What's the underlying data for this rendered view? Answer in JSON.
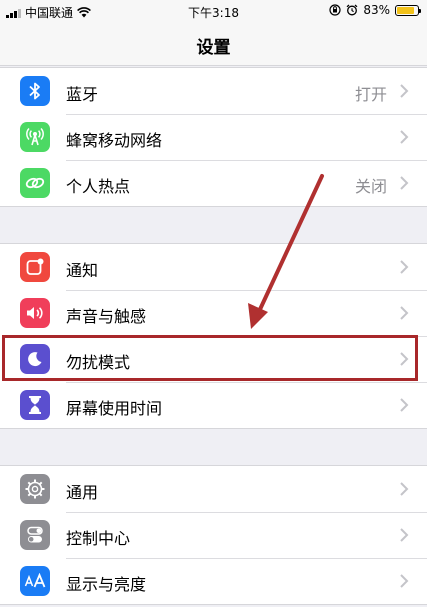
{
  "status_bar": {
    "carrier": "中国联通",
    "time": "下午3:18",
    "battery_percent": "83%",
    "battery_level": 0.83
  },
  "nav": {
    "title": "设置"
  },
  "groups": [
    {
      "items": [
        {
          "label": "蓝牙",
          "value": "打开",
          "icon": "bluetooth-icon",
          "color": "#1a7cf5"
        },
        {
          "label": "蜂窝移动网络",
          "value": "",
          "icon": "cellular-antenna-icon",
          "color": "#4cd964"
        },
        {
          "label": "个人热点",
          "value": "关闭",
          "icon": "personal-hotspot-icon",
          "color": "#4cd964"
        }
      ]
    },
    {
      "items": [
        {
          "label": "通知",
          "value": "",
          "icon": "notifications-icon",
          "color": "#f0483e"
        },
        {
          "label": "声音与触感",
          "value": "",
          "icon": "speaker-icon",
          "color": "#f03e5a"
        },
        {
          "label": "勿扰模式",
          "value": "",
          "icon": "moon-icon",
          "color": "#5b4fcf"
        },
        {
          "label": "屏幕使用时间",
          "value": "",
          "icon": "hourglass-icon",
          "color": "#5b4fcf"
        }
      ]
    },
    {
      "items": [
        {
          "label": "通用",
          "value": "",
          "icon": "gear-icon",
          "color": "#8e8e93"
        },
        {
          "label": "控制中心",
          "value": "",
          "icon": "toggle-switches-icon",
          "color": "#8e8e93"
        },
        {
          "label": "显示与亮度",
          "value": "",
          "icon": "display-text-size-icon",
          "color": "#1a7cf5"
        }
      ]
    }
  ],
  "annotation": {
    "highlight_color": "#a8282a",
    "arrow_color": "#b03030"
  }
}
